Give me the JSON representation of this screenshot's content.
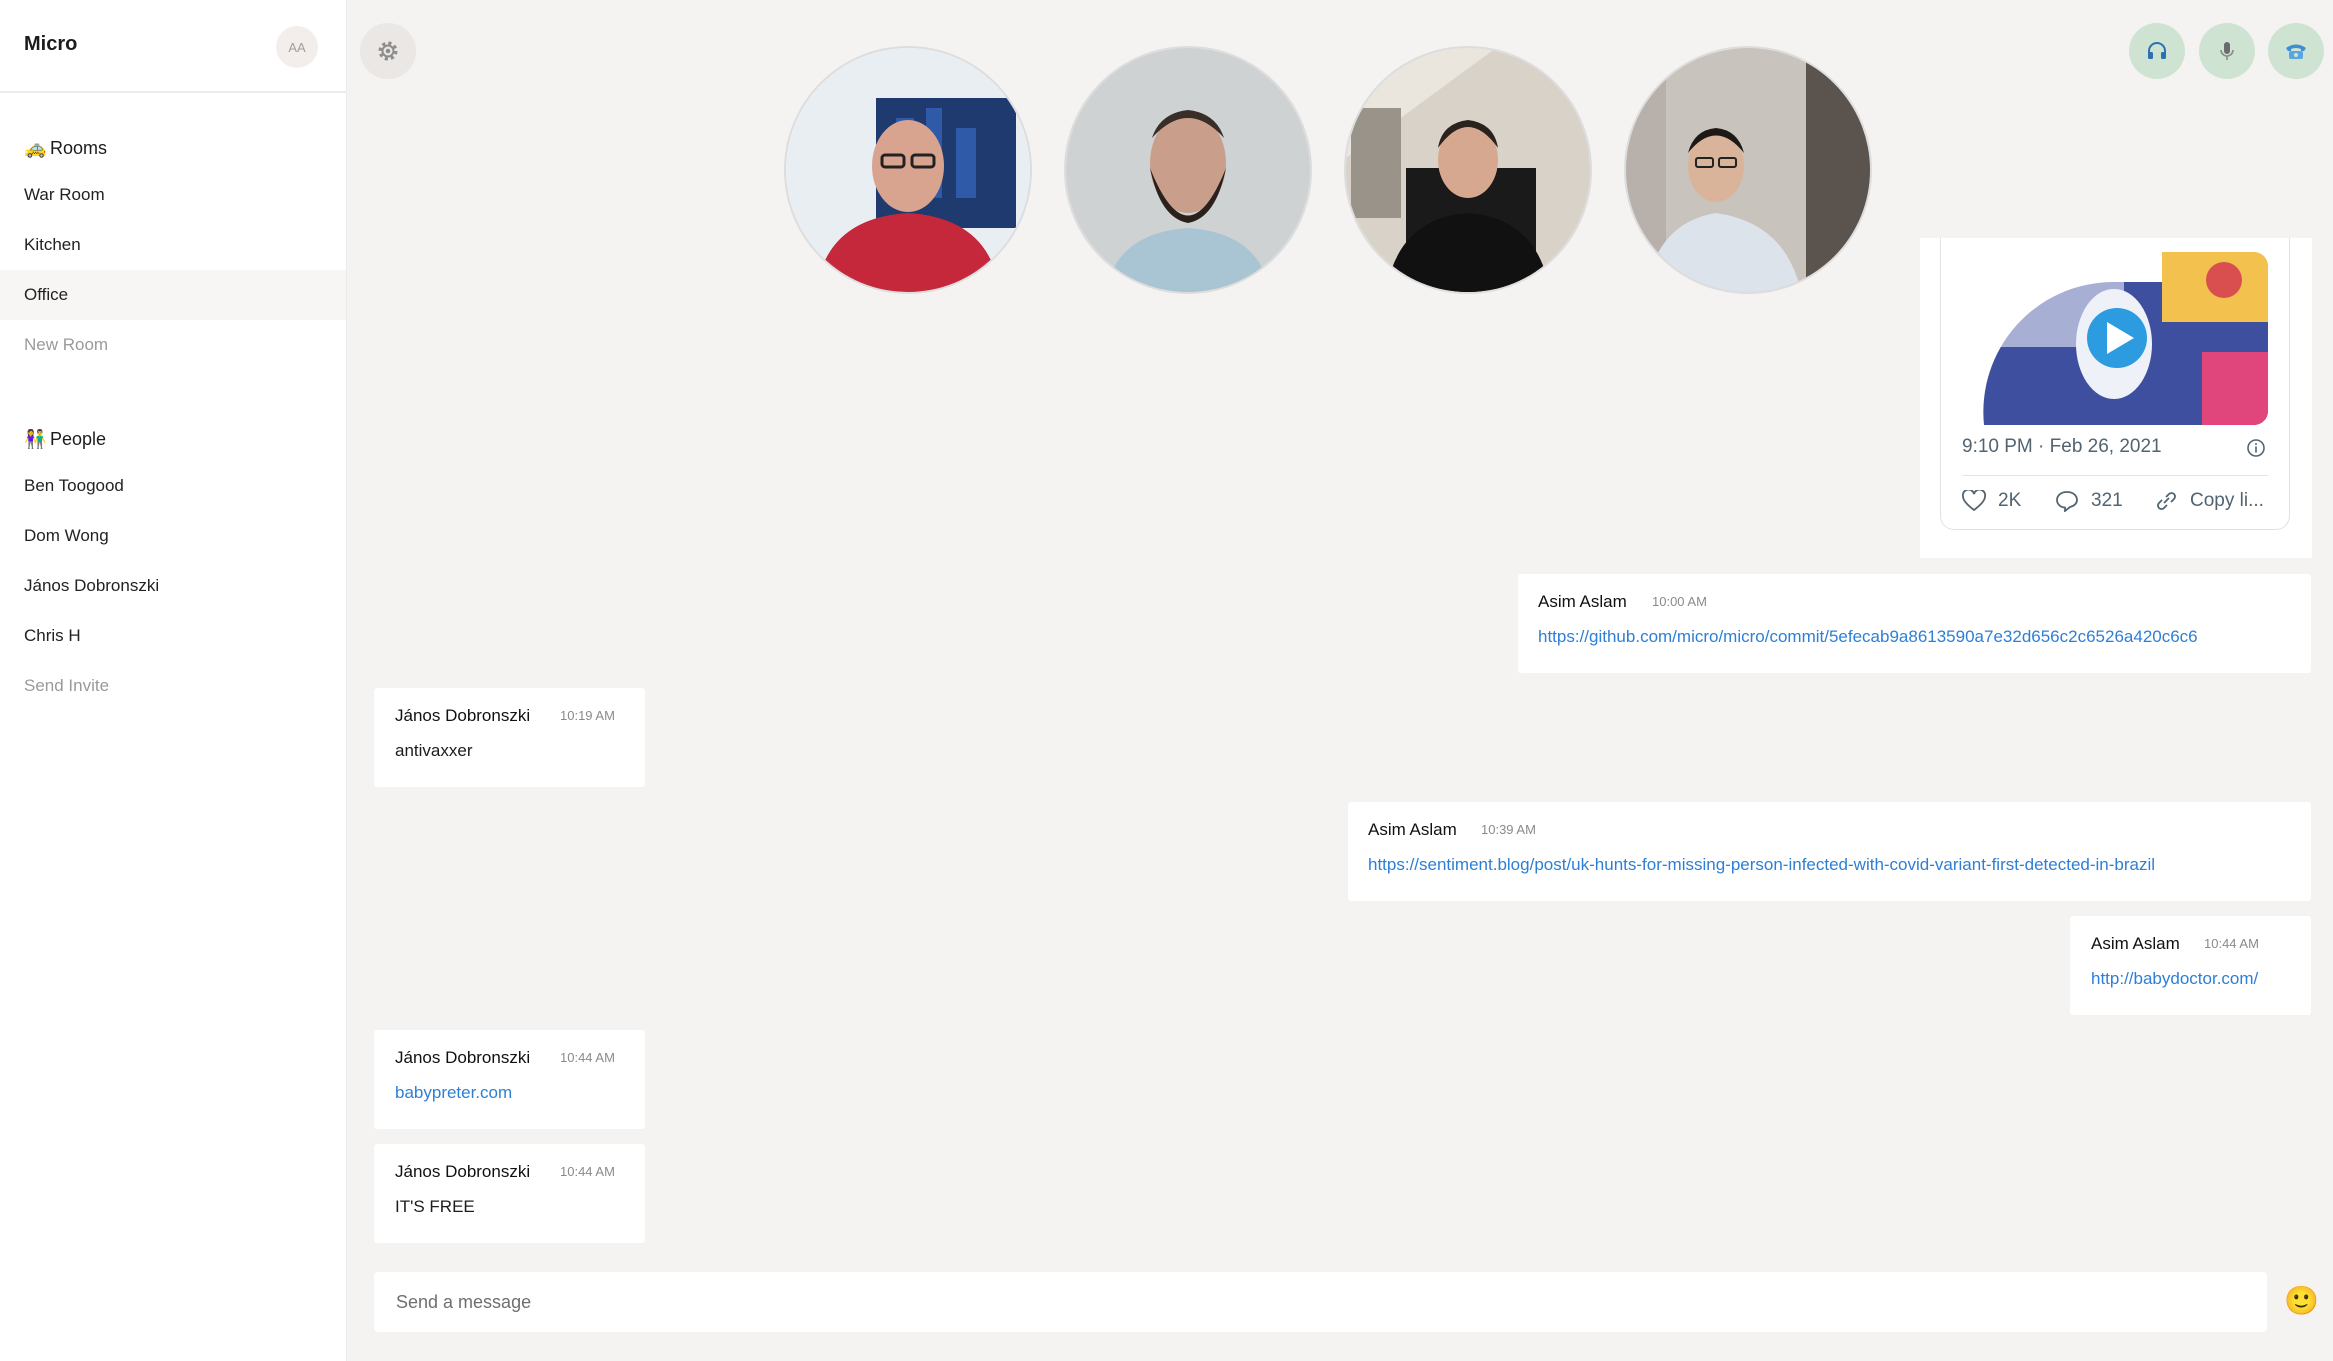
{
  "app": {
    "title": "Micro",
    "avatar_initials": "AA"
  },
  "sidebar": {
    "rooms_header": {
      "emoji": "🚕",
      "label": "Rooms"
    },
    "rooms": [
      "War Room",
      "Kitchen",
      "Office"
    ],
    "active_room": "Office",
    "new_room_label": "New Room",
    "people_header": {
      "emoji": "👫",
      "label": "People"
    },
    "people": [
      "Ben Toogood",
      "Dom Wong",
      "János Dobronszki",
      "Chris H"
    ],
    "send_invite_label": "Send Invite"
  },
  "controls": {
    "settings_icon": "gear-icon",
    "headphones_icon": "headphones-icon",
    "microphone_icon": "microphone-icon",
    "phone_icon": "phone-icon",
    "accent": "#cfe3d2"
  },
  "tweet": {
    "time": "9:10 PM · Feb 26, 2021",
    "likes": "2K",
    "replies": "321",
    "copy_label": "Copy li..."
  },
  "messages": [
    {
      "author": "Asim Aslam",
      "time": "10:00 AM",
      "text": "https://github.com/micro/micro/commit/5efecab9a8613590a7e32d656c2c6526a420c6c6",
      "is_link": true
    },
    {
      "author": "János Dobronszki",
      "time": "10:19 AM",
      "text": "antivaxxer",
      "is_link": false
    },
    {
      "author": "Asim Aslam",
      "time": "10:39 AM",
      "text": "https://sentiment.blog/post/uk-hunts-for-missing-person-infected-with-covid-variant-first-detected-in-brazil",
      "is_link": true
    },
    {
      "author": "Asim Aslam",
      "time": "10:44 AM",
      "text": "http://babydoctor.com/",
      "is_link": true
    },
    {
      "author": "János Dobronszki",
      "time": "10:44 AM",
      "text": "babypreter.com",
      "is_link": true
    },
    {
      "author": "János Dobronszki",
      "time": "10:44 AM",
      "text": "IT'S FREE",
      "is_link": false
    }
  ],
  "composer": {
    "placeholder": "Send a message",
    "emoji": "🙂"
  },
  "colors": {
    "link": "#2d7fd6",
    "background": "#f5f3f2"
  }
}
